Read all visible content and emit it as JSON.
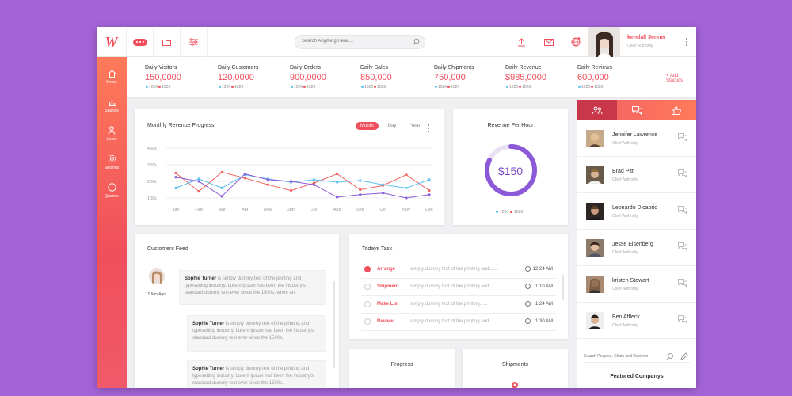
{
  "header": {
    "search_placeholder": "Search Anything Here....",
    "user_name": "kendall Jenner",
    "user_role": "Chief Authority"
  },
  "sidebar": {
    "items": [
      {
        "label": "Home",
        "icon": "home-icon"
      },
      {
        "label": "Stactics",
        "icon": "bar-chart-icon"
      },
      {
        "label": "Users",
        "icon": "users-icon"
      },
      {
        "label": "Settings",
        "icon": "gear-icon"
      },
      {
        "label": "Quaries",
        "icon": "info-icon"
      }
    ]
  },
  "stats": [
    {
      "title": "Daily Visitors",
      "value": "150,0000",
      "a": "1020",
      "b": "1020"
    },
    {
      "title": "Daily Customers",
      "value": "120,0000",
      "a": "1020",
      "b": "1020"
    },
    {
      "title": "Daily Orders",
      "value": "900,0000",
      "a": "1020",
      "b": "1020"
    },
    {
      "title": "Daily Sales",
      "value": "850,000",
      "a": "1020",
      "b": "1020"
    },
    {
      "title": "Daily Shipments",
      "value": "750,000",
      "a": "1020",
      "b": "1020"
    },
    {
      "title": "Daily Revenue",
      "value": "$985,0000",
      "a": "1020",
      "b": "1020"
    },
    {
      "title": "Daily Reviews",
      "value": "600,000",
      "a": "1020",
      "b": "1020"
    }
  ],
  "add_statics": "+ Add Stactics",
  "revenue_chart": {
    "title": "Monthly Revenue Progress",
    "tabs": [
      "Month",
      "Day",
      "Year"
    ]
  },
  "chart_data": {
    "type": "line",
    "title": "Monthly Revenue Progress",
    "categories": [
      "Jan",
      "Feb",
      "Mar",
      "Apr",
      "May",
      "Jun",
      "Jul",
      "Aug",
      "Sep",
      "Oct",
      "Nov",
      "Dec"
    ],
    "yticks": [
      "400k",
      "300k",
      "200k",
      "100k"
    ],
    "ylim": [
      100000,
      400000
    ],
    "series": [
      {
        "color": "#f0605e",
        "values": [
          250000,
          140000,
          255000,
          220000,
          180000,
          145000,
          190000,
          245000,
          150000,
          175000,
          240000,
          145000
        ]
      },
      {
        "color": "#5bc0f0",
        "values": [
          160000,
          215000,
          160000,
          240000,
          215000,
          195000,
          210000,
          195000,
          205000,
          180000,
          160000,
          210000
        ]
      },
      {
        "color": "#8c59d8",
        "values": [
          225000,
          200000,
          110000,
          245000,
          210000,
          200000,
          180000,
          105000,
          120000,
          130000,
          100000,
          120000
        ]
      }
    ],
    "colors": {
      "red": "#f0605e",
      "blue": "#5bc0f0",
      "purple": "#8c59d8"
    }
  },
  "rev_hour": {
    "title": "Revenue Per Hour",
    "value": "$150",
    "a": "1020",
    "b": "1020",
    "fraction": 0.82
  },
  "feed": {
    "title": "Customers Feed",
    "time": "10 Min Ago",
    "items": [
      {
        "name": "Sophie Turner",
        "text": " is simply dummy text of the printing and typesetting industry. Lorem Ipsum has been the industry's standard dummy text ever since the 1500s, when an"
      },
      {
        "name": "Sophie Turner",
        "text": " is simply dummy text of the printing and typesetting industry. Lorem Ipsum has been the industry's standard dummy text ever since the 1500s,"
      },
      {
        "name": "Sophie Turner",
        "text": " is simply dummy text of the printing and typesetting industry. Lorem Ipsum has been the industry's standard dummy text ever since the 1500s."
      }
    ]
  },
  "tasks": {
    "title": "Todays Task",
    "items": [
      {
        "name": "Arrange",
        "desc": "simply dummy text of the printing and......",
        "time": "12:24 AM",
        "done": true
      },
      {
        "name": "Shipment",
        "desc": "simply dummy text of the printing and......",
        "time": "1:10 AM",
        "done": false
      },
      {
        "name": "Make List",
        "desc": "simply dummy text of the printing......",
        "time": "1:24 AM",
        "done": false
      },
      {
        "name": "Review",
        "desc": "simply dummy text of the printing and......",
        "time": "1:30 AM",
        "done": false
      }
    ]
  },
  "progress": {
    "title": "Progress"
  },
  "shipments": {
    "title": "Shipments"
  },
  "people": [
    {
      "name": "Jennifer Lawrence",
      "role": "Chief Authority"
    },
    {
      "name": "Brad Pitt",
      "role": "Chief Authority"
    },
    {
      "name": "Leonardo Dicaprio",
      "role": "Chief Authority"
    },
    {
      "name": "Jesse Eisenberg",
      "role": "Chief Authority"
    },
    {
      "name": "kristen Stewart",
      "role": "Chief Authority"
    },
    {
      "name": "Ben Affleck",
      "role": "Chief Authority"
    }
  ],
  "people_search_placeholder": "Search Peoples, Chats and Reviews",
  "featured": "Featured Companys",
  "accent": "#ef4f5c"
}
